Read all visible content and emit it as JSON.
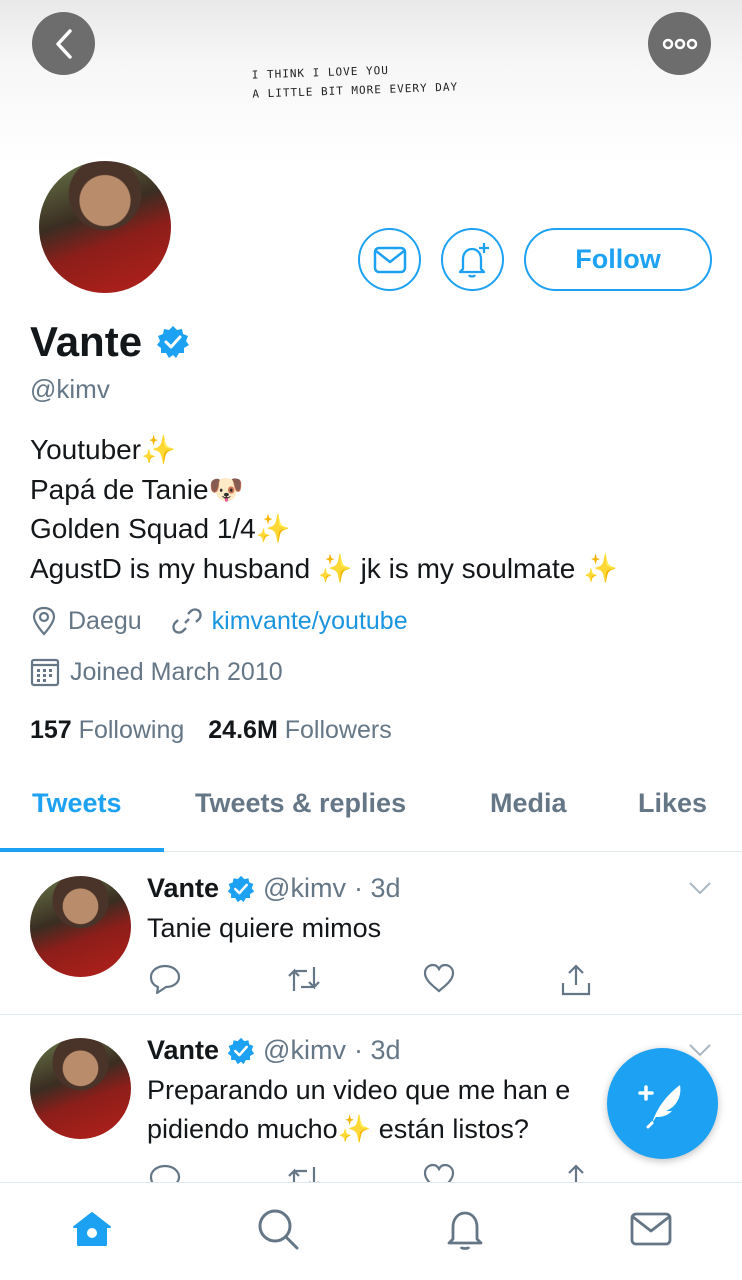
{
  "banner": {
    "line1": "I  THINK  I  LOVE  YOU",
    "line2": "A  LITTLE  BIT  MORE  EVERY  DAY"
  },
  "profile": {
    "name": "Vante",
    "handle": "@kimv",
    "bio": [
      {
        "text": "Youtuber",
        "emoji": "✨"
      },
      {
        "text": "Papá de Tanie",
        "emoji": "🐶"
      },
      {
        "text": "Golden Squad 1/4",
        "emoji": "✨"
      },
      {
        "text": "AgustD is my husband ",
        "emoji": "✨",
        "text2": " jk is my soulmate ",
        "emoji2": "✨"
      }
    ],
    "location": "Daegu",
    "link": "kimvante/youtube",
    "joined": "Joined March 2010",
    "following_count": "157",
    "following_label": "Following",
    "followers_count": "24.6M",
    "followers_label": "Followers",
    "follow_label": "Follow"
  },
  "tabs": [
    "Tweets",
    "Tweets & replies",
    "Media",
    "Likes"
  ],
  "tweets": [
    {
      "name": "Vante",
      "handle": "@kimv",
      "time": "· 3d",
      "text": "Tanie quiere mimos"
    },
    {
      "name": "Vante",
      "handle": "@kimv",
      "time": "· 3d",
      "text1": "Preparando un video que me han e",
      "text2": "pidiendo mucho",
      "emoji": "✨",
      "text3": " están listos?"
    }
  ],
  "colors": {
    "accent": "#1da1f2",
    "secondary_text": "#657786",
    "link": "#1b95e0",
    "divider": "#e1e8ed"
  }
}
